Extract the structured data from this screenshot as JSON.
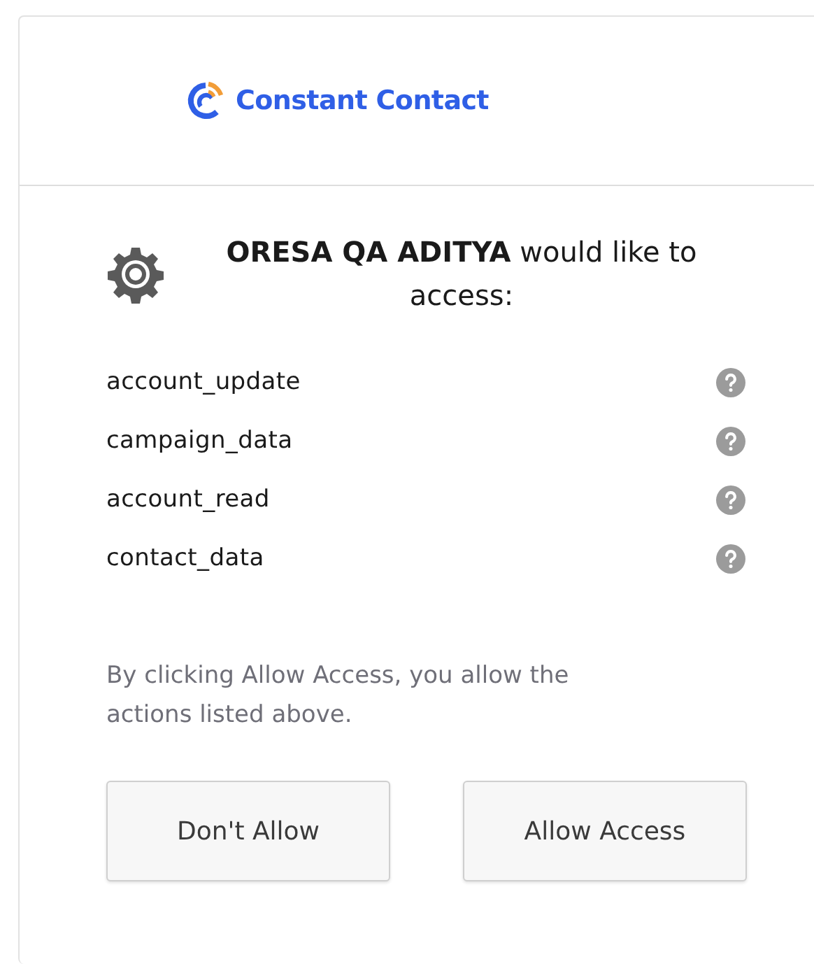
{
  "brand": {
    "name": "Constant Contact"
  },
  "request": {
    "heading": "**ORESA QA ADITYA** would like to access:"
  },
  "permissions": [
    {
      "scope": "account_update"
    },
    {
      "scope": "campaign_data"
    },
    {
      "scope": "account_read"
    },
    {
      "scope": "contact_data"
    }
  ],
  "notice": "By clicking Allow Access, you allow the actions listed above.",
  "buttons": [
    {
      "label": "Don't Allow"
    },
    {
      "label": "Allow Access"
    }
  ]
}
